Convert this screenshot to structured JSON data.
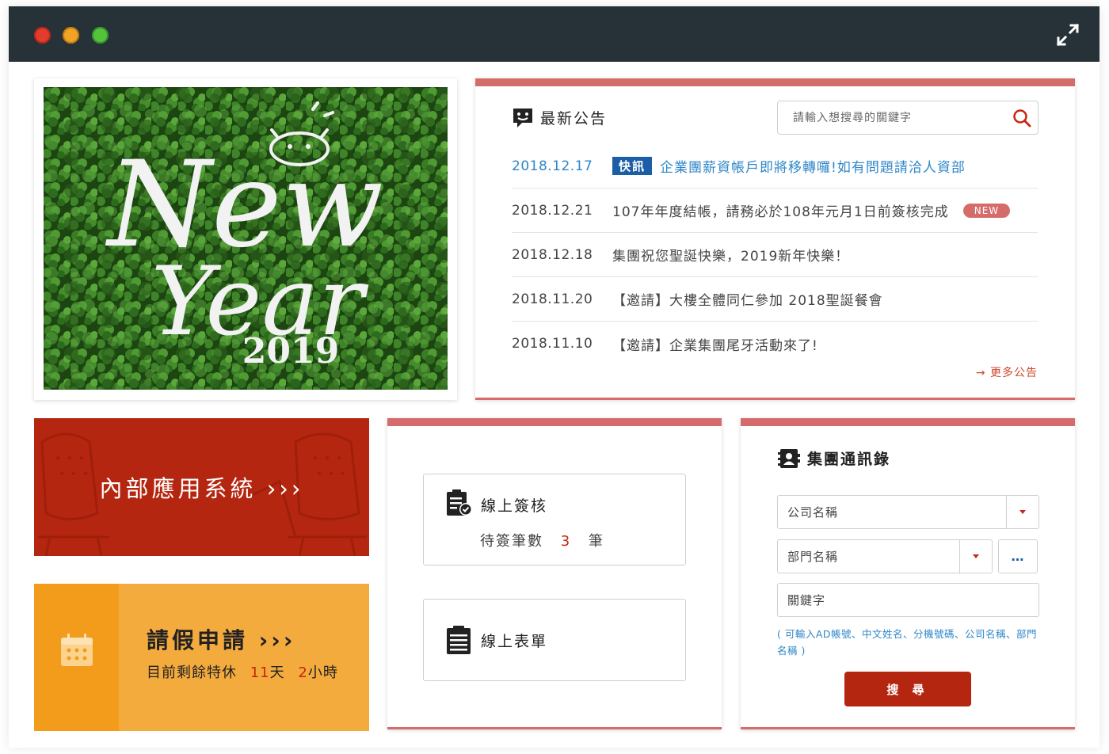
{
  "window": {
    "controls": [
      "close",
      "minimize",
      "zoom"
    ],
    "expand_icon": "expand-arrows-icon"
  },
  "banner": {
    "line1": "New",
    "line2": "Year",
    "year": "2019",
    "colors": {
      "leaves": "#2f6b1f",
      "lettering": "#f2f2f2"
    }
  },
  "announcements": {
    "title": "最新公告",
    "icon": "announcement-chat-icon",
    "search_placeholder": "請輸入想搜尋的關鍵字",
    "items": [
      {
        "date": "2018.12.17",
        "badge": "快訊",
        "text": "企業團薪資帳戶即將移轉囉!如有問題請洽人資部"
      },
      {
        "date": "2018.12.21",
        "text": "107年年度結帳，請務必於108年元月1日前簽核完成",
        "badge_new": "NEW"
      },
      {
        "date": "2018.12.18",
        "text": "集團祝您聖誕快樂，2019新年快樂！"
      },
      {
        "date": "2018.11.20",
        "text": "【邀請】大樓全體同仁參加 2018聖誕餐會"
      },
      {
        "date": "2018.11.10",
        "text": "【邀請】企業集團尾牙活動來了!"
      }
    ],
    "more": "→ 更多公告"
  },
  "internal_system": {
    "label": "內部應用系統 ›››"
  },
  "leave": {
    "title": "請假申請 ›››",
    "remaining_prefix": "目前剩餘特休",
    "days_value": "11",
    "days_unit": "天",
    "hours_value": "2",
    "hours_unit": "小時"
  },
  "signoff": {
    "title": "線上簽核",
    "pending_prefix": "待簽筆數",
    "pending_count": "3",
    "pending_unit": "筆"
  },
  "forms": {
    "title": "線上表單"
  },
  "directory": {
    "title": "集團通訊錄",
    "company_placeholder": "公司名稱",
    "department_placeholder": "部門名稱",
    "keyword_placeholder": "關鍵字",
    "more_button": "…",
    "hint": "( 可輸入AD帳號、中文姓名、分機號碼、公司名稱、部門名稱 )",
    "search_button": "搜 尋"
  },
  "colors": {
    "accent_red": "#b52610",
    "card_bar": "#d66b6b",
    "link_blue": "#2e86c8",
    "badge_blue": "#1b5ea5",
    "leave_orange": "#f4ab3d",
    "titlebar": "#263238"
  }
}
